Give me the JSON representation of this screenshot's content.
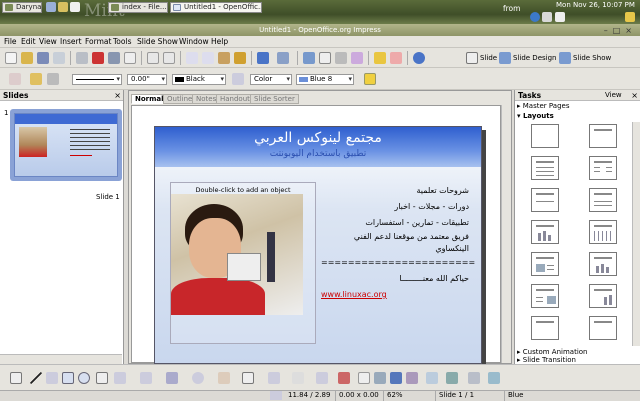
{
  "panel": {
    "tasks": [
      {
        "label": "Daryna"
      },
      {
        "label": "index - File..."
      },
      {
        "label": "Untitled1 - OpenOffic..."
      }
    ],
    "from_text": "from",
    "clock": "Mon Nov 26, 10:07 PM",
    "logo_text": "Mint",
    "tray_icons": [
      "globe-icon",
      "network-icon",
      "volume-icon",
      "update-icon"
    ]
  },
  "window": {
    "title": "Untitled1 - OpenOffice.org Impress"
  },
  "menu": [
    "File",
    "Edit",
    "View",
    "Insert",
    "Format",
    "Tools",
    "Slide Show",
    "Window",
    "Help"
  ],
  "toolbar1": {
    "slide_label": "Slide",
    "slide_design_label": "Slide Design",
    "slide_show_label": "Slide Show"
  },
  "toolbar2": {
    "line_width": "0.00\"",
    "line_color": "Black",
    "area_style": "Color",
    "area_color": "Blue 8"
  },
  "slides_pane": {
    "title": "Slides",
    "slide_number": "1",
    "slide_label": "Slide 1"
  },
  "view_tabs": [
    "Normal",
    "Outline",
    "Notes",
    "Handout",
    "Slide Sorter"
  ],
  "slide": {
    "title": "مجتمع لينوكس العربي",
    "subtitle": "تطبيق باستخدام اليوبونتت",
    "object_hint": "Double-click to add an object",
    "lines": [
      "شروحات تعلمية",
      "دورات - مجلات - اخبار",
      "تطبيقات - تمارين - استفسارات",
      "فريق معتمد من موقعنا لدعم الفني",
      "الينكساوي",
      "=======================",
      "حياكم الله معنـــــــــا"
    ],
    "link": "www.linuxac.org"
  },
  "tasks_pane": {
    "title": "Tasks",
    "view_label": "View",
    "sections": {
      "master_pages": "Master Pages",
      "layouts": "Layouts",
      "custom_animation": "Custom Animation",
      "slide_transition": "Slide Transition"
    }
  },
  "status": {
    "position": "11.84 / 2.89",
    "size": "0.00 x 0.00",
    "zoom": "62%",
    "slide": "Slide 1 / 1",
    "master": "Blue"
  },
  "colors": {
    "accent": "#2f5fcf",
    "link": "#cc0000"
  }
}
